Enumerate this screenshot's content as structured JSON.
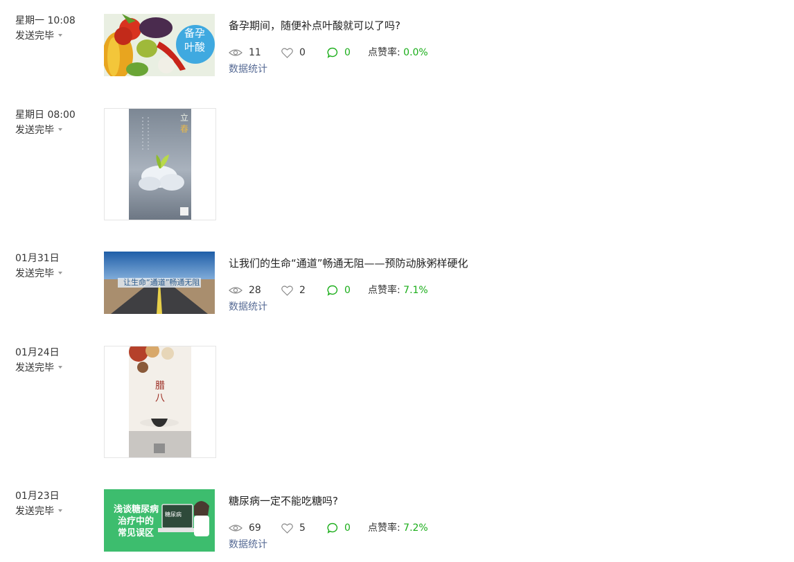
{
  "articles": [
    {
      "time": "星期一 10:08",
      "status": "发送完毕",
      "title": "备孕期间，随便补点叶酸就可以了吗?",
      "views": "11",
      "likes": "0",
      "comments": "0",
      "rate_label": "点赞率:",
      "rate": "0.0%",
      "stats_link": "数据统计",
      "thumb_text": [
        "备孕",
        "叶酸"
      ]
    },
    {
      "time": "星期日 08:00",
      "status": "发送完毕",
      "thumb_text": [
        "立",
        "春"
      ]
    },
    {
      "time": "01月31日",
      "status": "发送完毕",
      "title": "让我们的生命“通道”畅通无阻——预防动脉粥样硬化",
      "views": "28",
      "likes": "2",
      "comments": "0",
      "rate_label": "点赞率:",
      "rate": "7.1%",
      "stats_link": "数据统计",
      "thumb_text": [
        "让生命“通道”畅通无阻"
      ]
    },
    {
      "time": "01月24日",
      "status": "发送完毕",
      "thumb_text": [
        "腊",
        "八"
      ]
    },
    {
      "time": "01月23日",
      "status": "发送完毕",
      "title": "糖尿病一定不能吃糖吗?",
      "views": "69",
      "likes": "5",
      "comments": "0",
      "rate_label": "点赞率:",
      "rate": "7.2%",
      "stats_link": "数据统计",
      "thumb_text": [
        "浅谈糖尿病",
        "治疗中的",
        "常见误区",
        "糖尿病"
      ]
    }
  ],
  "colors": {
    "accent_green": "#1aad19",
    "link_blue": "#576b95"
  },
  "icons": {
    "views": "eye-icon",
    "likes": "heart-icon",
    "comments": "comment-bubble-icon",
    "status": "caret-down-icon"
  }
}
